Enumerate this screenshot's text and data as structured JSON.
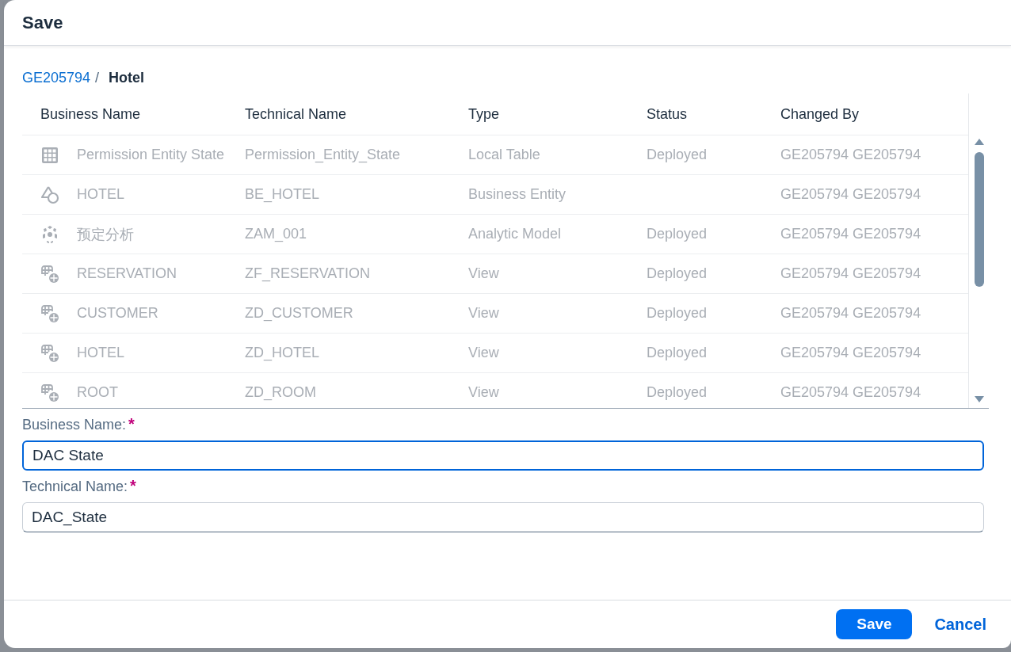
{
  "dialog": {
    "title": "Save"
  },
  "breadcrumb": {
    "parent": "GE205794",
    "separator": "/",
    "current": "Hotel"
  },
  "table": {
    "columns": [
      "Business Name",
      "Technical Name",
      "Type",
      "Status",
      "Changed By"
    ],
    "rows": [
      {
        "kind": "table",
        "business_name": "Permission Entity State",
        "technical_name": "Permission_Entity_State",
        "type": "Local Table",
        "status": "Deployed",
        "changed_by": "GE205794 GE205794"
      },
      {
        "kind": "entity",
        "business_name": "HOTEL",
        "technical_name": "BE_HOTEL",
        "type": "Business Entity",
        "changed_by": "GE205794 GE205794"
      },
      {
        "kind": "model",
        "business_name": "预定分析",
        "technical_name": "ZAM_001",
        "type": "Analytic Model",
        "status": "Deployed",
        "changed_by": "GE205794 GE205794"
      },
      {
        "kind": "view",
        "business_name": "RESERVATION",
        "technical_name": "ZF_RESERVATION",
        "type": "View",
        "status": "Deployed",
        "changed_by": "GE205794 GE205794"
      },
      {
        "kind": "view",
        "business_name": "CUSTOMER",
        "technical_name": "ZD_CUSTOMER",
        "type": "View",
        "status": "Deployed",
        "changed_by": "GE205794 GE205794"
      },
      {
        "kind": "view",
        "business_name": "HOTEL",
        "technical_name": "ZD_HOTEL",
        "type": "View",
        "status": "Deployed",
        "changed_by": "GE205794 GE205794"
      },
      {
        "kind": "view",
        "business_name": "ROOT",
        "technical_name": "ZD_ROOM",
        "type": "View",
        "status": "Deployed",
        "changed_by": "GE205794 GE205794"
      }
    ]
  },
  "form": [
    {
      "label": "Business Name:",
      "required_mark": "*",
      "value": "DAC State",
      "focused": true
    },
    {
      "label": "Technical Name:",
      "required_mark": "*",
      "value": "DAC_State",
      "focused": false
    }
  ],
  "buttons": {
    "save": "Save",
    "cancel": "Cancel"
  }
}
